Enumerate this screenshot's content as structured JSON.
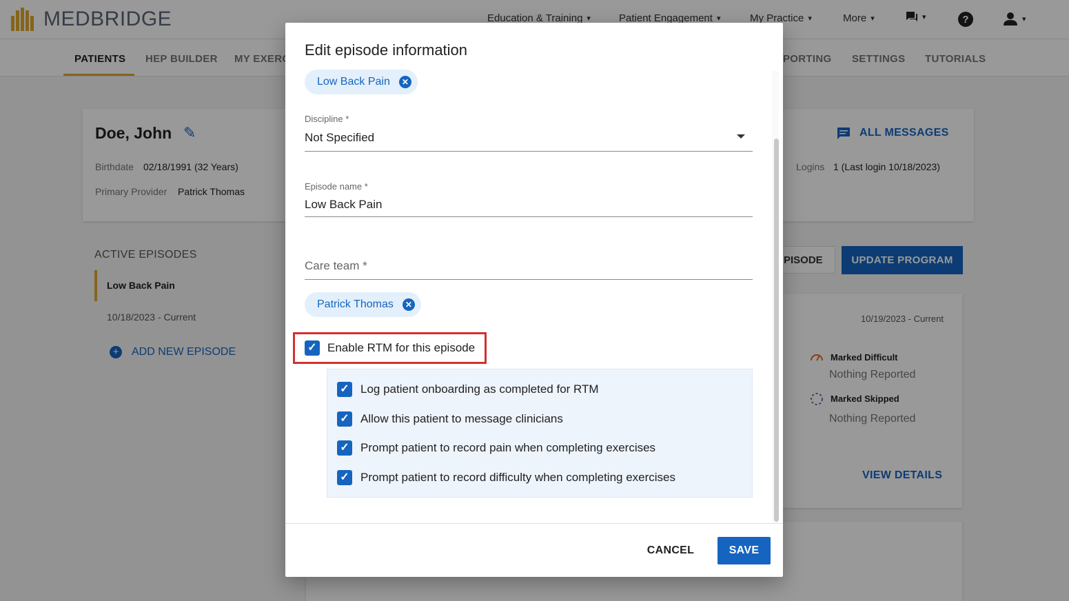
{
  "app": {
    "logo_text": "MEDBRIDGE",
    "top_nav": [
      "Education & Training",
      "Patient Engagement",
      "My Practice",
      "More"
    ],
    "sub_tabs": [
      "PATIENTS",
      "HEP BUILDER",
      "MY EXERC",
      "PORTING",
      "SETTINGS",
      "TUTORIALS"
    ]
  },
  "patient": {
    "name": "Doe, John",
    "birthdate_label": "Birthdate",
    "birthdate": "02/18/1991 (32 Years)",
    "provider_label": "Primary Provider",
    "provider": "Patrick Thomas",
    "logins_label": "Logins",
    "logins": "1 (Last login 10/18/2023)",
    "all_messages": "ALL MESSAGES"
  },
  "episodes": {
    "heading": "ACTIVE EPISODES",
    "items": [
      {
        "name": "Low Back Pain",
        "date": "10/18/2023 - Current"
      }
    ],
    "add_label": "ADD NEW EPISODE"
  },
  "program": {
    "episode_button": "PISODE",
    "update_button": "UPDATE PROGRAM",
    "date_range": "10/19/2023 - Current",
    "marked_difficult": "Marked Difficult",
    "difficult_value": "Nothing Reported",
    "marked_skipped": "Marked Skipped",
    "skipped_value": "Nothing Reported",
    "view_details": "VIEW DETAILS"
  },
  "modal": {
    "title": "Edit episode information",
    "condition_chip": "Low Back Pain",
    "discipline_label": "Discipline *",
    "discipline_value": "Not Specified",
    "episode_name_label": "Episode name *",
    "episode_name_value": "Low Back Pain",
    "care_team_label": "Care team *",
    "care_team_chip": "Patrick Thomas",
    "rtm_label": "Enable RTM for this episode",
    "rtm_options": [
      "Log patient onboarding as completed for RTM",
      "Allow this patient to message clinicians",
      "Prompt patient to record pain when completing exercises",
      "Prompt patient to record difficulty when completing exercises"
    ],
    "cancel": "CANCEL",
    "save": "SAVE"
  },
  "colors": {
    "primary": "#1565c0",
    "accent": "#e0a72e",
    "highlight": "#d32f2f",
    "chip_bg": "#e3f0fb"
  },
  "icons": {
    "close_chip": "✕",
    "check": "✓",
    "chevron": "⌄",
    "edit": "✎",
    "add": "+"
  }
}
